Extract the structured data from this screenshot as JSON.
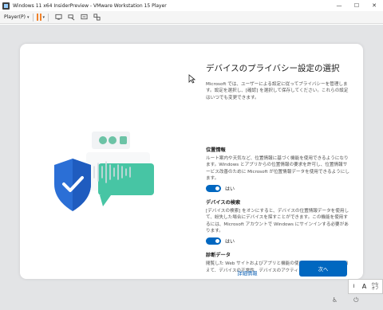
{
  "window": {
    "title": "Windows 11 x64 InsiderPreview - VMware Workstation 15 Player",
    "minimize_glyph": "—",
    "maximize_glyph": "☐",
    "close_glyph": "✕"
  },
  "toolbar": {
    "player_menu": "Player(P)",
    "caret": "▾"
  },
  "oobe": {
    "heading": "デバイスのプライバシー設定の選択",
    "intro": "Microsoft では、ユーザーによる設定に従ってプライバシーを管理します。設定を選択し、[確認] を選択して保存してください。これらの設定はいつでも変更できます。",
    "sections": [
      {
        "title": "位置情報",
        "description": "ルート案内や天気など、位置情報に基づく機能を使用できるようになります。Windows とアプリからの位置情報の要求を許可し、位置情報サービス改善のために Microsoft が位置情報データを使用できるようにします。",
        "toggle_label": "はい",
        "toggle_on": true
      },
      {
        "title": "デバイスの検索",
        "description": "[デバイスの検索] をオンにすると、デバイスの位置情報データを使用して、紛失した場合にデバイスを探すことができます。この機能を使用するには、Microsoft アカウントで Windows にサインインする必要があります。",
        "toggle_label": "はい",
        "toggle_on": true
      },
      {
        "title": "診断データ",
        "description": "閲覧した Web サイトおよびアプリと機能の使用方法に関する情報に加えて、デバイスの正常性、デバイスのアクティビティ、機能強化の使用状況、およびエラー報告に関する追加情報を送信します。"
      }
    ],
    "details_button": "詳細情報",
    "next_button": "次へ"
  },
  "ime": {
    "mode_a": "A",
    "kana_top": "かな",
    "kana_bottom": "オフ"
  },
  "colors": {
    "accent": "#0067c0",
    "pause": "#f0822a"
  }
}
